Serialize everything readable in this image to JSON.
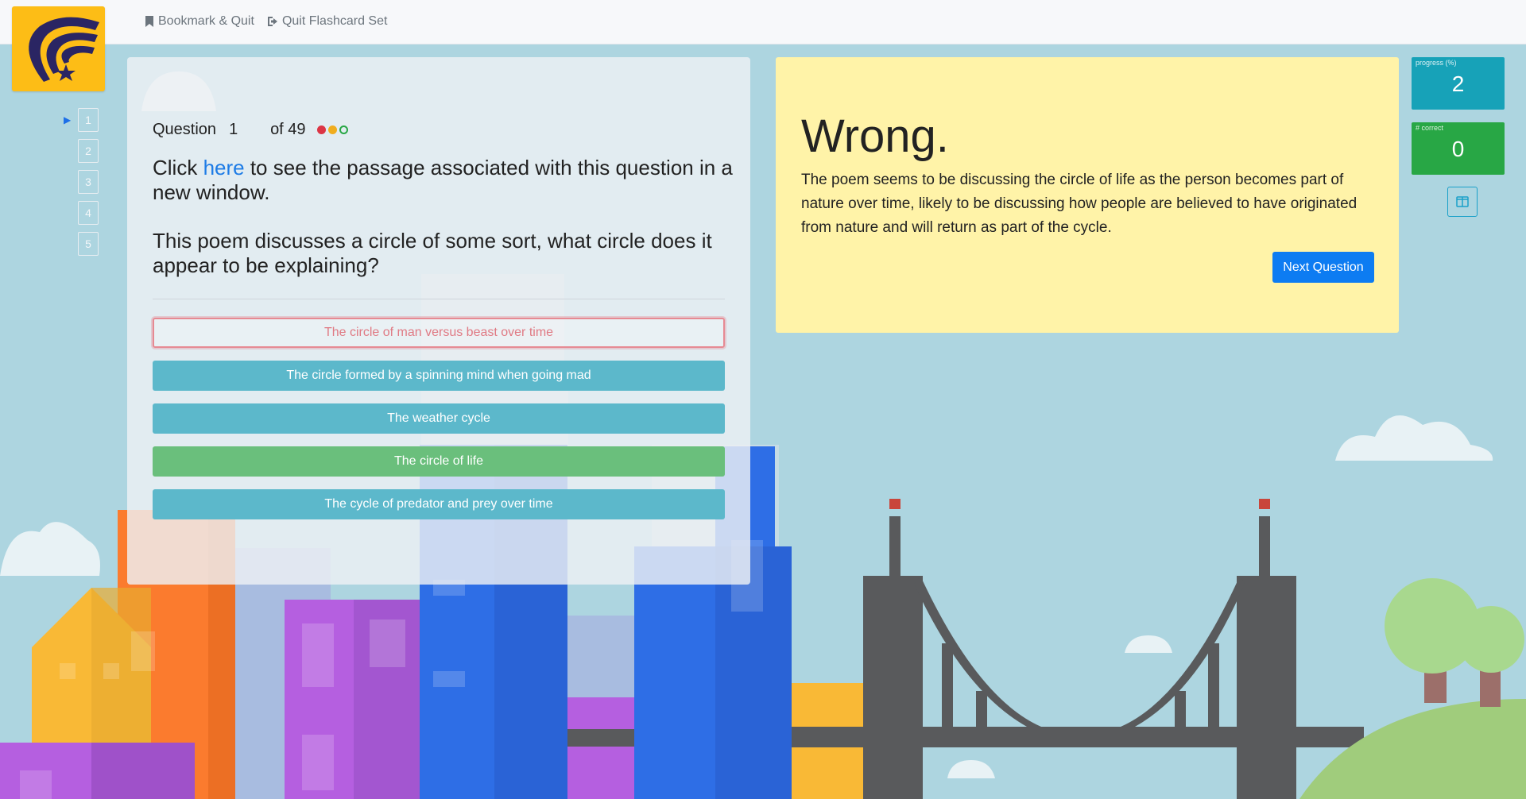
{
  "nav": {
    "bookmark_label": "Bookmark & Quit",
    "quit_label": "Quit Flashcard Set"
  },
  "question_nav": {
    "items": [
      "1",
      "2",
      "3",
      "4",
      "5"
    ],
    "current": "1"
  },
  "question": {
    "label": "Question",
    "number": "1",
    "total": "of 49",
    "passage_prefix": "Click ",
    "passage_link": "here",
    "passage_suffix": " to see the passage associated with this question in a new window.",
    "prompt": "This poem discusses a circle of some sort, what circle does it appear to be explaining?"
  },
  "choices": [
    {
      "label": "The circle of man versus beast over time",
      "state": "wrong"
    },
    {
      "label": "The circle formed by a spinning mind when going mad",
      "state": "info"
    },
    {
      "label": "The weather cycle",
      "state": "info"
    },
    {
      "label": "The circle of life",
      "state": "success"
    },
    {
      "label": "The cycle of predator and prey over time",
      "state": "info"
    }
  ],
  "feedback": {
    "title": "Wrong.",
    "explanation": "The poem seems to be discussing the circle of life as the person becomes part of nature over time, likely to be discussing how people are believed to have originated from nature and will return as part of the cycle.",
    "next_label": "Next Question"
  },
  "stats": {
    "progress_label": "progress (%)",
    "progress_value": "2",
    "correct_label": "# correct",
    "correct_value": "0"
  },
  "colors": {
    "sky": "#add5e0",
    "logo": "#fdbd16",
    "feedback_bg": "#fff3a8",
    "primary": "#0d7cf2",
    "info": "#17a2b8",
    "success": "#28a745",
    "danger": "#dc3545"
  },
  "icons": {
    "bookmark": "bookmark-icon",
    "quit": "sign-out-icon",
    "layout": "columns-icon",
    "current_arrow": "play-icon"
  }
}
